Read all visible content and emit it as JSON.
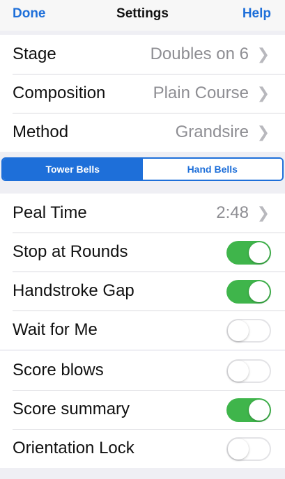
{
  "navbar": {
    "done_label": "Done",
    "title": "Settings",
    "help_label": "Help"
  },
  "group1": {
    "rows": [
      {
        "label": "Stage",
        "value": "Doubles on 6"
      },
      {
        "label": "Composition",
        "value": "Plain Course"
      },
      {
        "label": "Method",
        "value": "Grandsire"
      }
    ]
  },
  "segmented": {
    "options": [
      "Tower Bells",
      "Hand Bells"
    ],
    "selected": "Tower Bells"
  },
  "group2": {
    "peal_time": {
      "label": "Peal Time",
      "value": "2:48"
    },
    "toggles": [
      {
        "label": "Stop at Rounds",
        "on": true
      },
      {
        "label": "Handstroke Gap",
        "on": true
      },
      {
        "label": "Wait for Me",
        "on": false
      }
    ]
  },
  "group3": {
    "toggles": [
      {
        "label": "Score blows",
        "on": false
      },
      {
        "label": "Score summary",
        "on": true
      },
      {
        "label": "Orientation Lock",
        "on": false
      }
    ]
  },
  "icons": {
    "chevron": "chevron-right-icon"
  },
  "colors": {
    "accent": "#1e6fd9",
    "toggle_on": "#3fb54b",
    "background": "#efeff4"
  }
}
